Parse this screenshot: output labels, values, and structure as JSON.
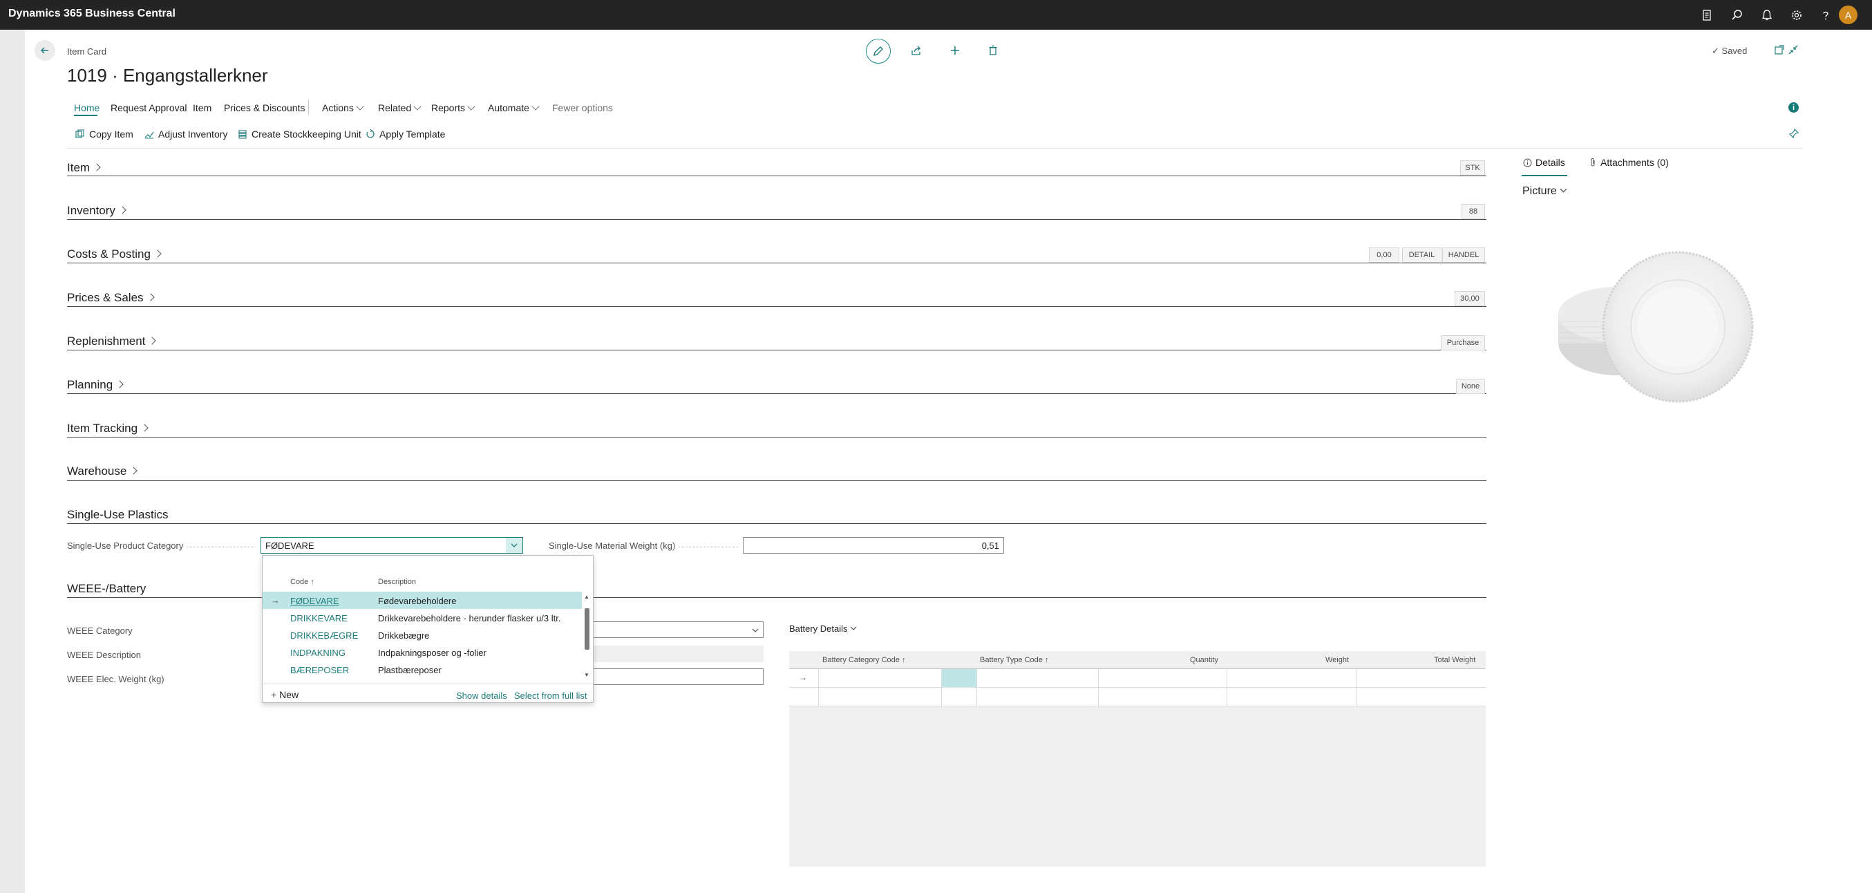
{
  "app": {
    "title": "Dynamics 365 Business Central",
    "avatar_initial": "A"
  },
  "header": {
    "breadcrumb": "Item Card",
    "title": "1019 · Engangstallerkner",
    "saved_label": "Saved"
  },
  "menu": {
    "items": [
      "Home",
      "Request Approval",
      "Item",
      "Prices & Discounts"
    ],
    "dropdowns": [
      "Actions",
      "Related",
      "Reports",
      "Automate"
    ],
    "fewer": "Fewer options"
  },
  "actions": [
    "Copy Item",
    "Adjust Inventory",
    "Create Stockkeeping Unit",
    "Apply Template"
  ],
  "fasttabs": [
    {
      "title": "Item",
      "badges": [
        "STK"
      ]
    },
    {
      "title": "Inventory",
      "badges": [
        "88"
      ]
    },
    {
      "title": "Costs & Posting",
      "badges": [
        "0,00",
        "DETAIL",
        "HANDEL"
      ]
    },
    {
      "title": "Prices & Sales",
      "badges": [
        "30,00"
      ]
    },
    {
      "title": "Replenishment",
      "badges": [
        "Purchase"
      ]
    },
    {
      "title": "Planning",
      "badges": [
        "None"
      ]
    },
    {
      "title": "Item Tracking",
      "badges": []
    },
    {
      "title": "Warehouse",
      "badges": []
    }
  ],
  "single_use": {
    "title": "Single-Use Plastics",
    "category_label": "Single-Use Product Category",
    "category_value": "FØDEVARE",
    "weight_label": "Single-Use Material Weight (kg)",
    "weight_value": "0,51"
  },
  "lookup": {
    "code_header": "Code ↑",
    "desc_header": "Description",
    "rows": [
      {
        "code": "FØDEVARE",
        "desc": "Fødevarebeholdere"
      },
      {
        "code": "DRIKKEVARE",
        "desc": "Drikkevarebeholdere - herunder flasker u/3 ltr."
      },
      {
        "code": "DRIKKEBÆGRE",
        "desc": "Drikkebægre"
      },
      {
        "code": "INDPAKNING",
        "desc": "Indpakningsposer og -folier"
      },
      {
        "code": "BÆREPOSER",
        "desc": "Plastbæreposer"
      }
    ],
    "new_label": "New",
    "show_details": "Show details",
    "select_full": "Select from full list"
  },
  "weee": {
    "title": "WEEE-/Battery",
    "category_label": "WEEE Category",
    "description_label": "WEEE Description",
    "weight_label": "WEEE Elec. Weight (kg)"
  },
  "battery": {
    "title": "Battery Details",
    "columns": [
      "Battery Category Code ↑",
      "Battery Type Code ↑",
      "Quantity",
      "Weight",
      "Total Weight"
    ]
  },
  "right_pane": {
    "tabs": [
      "Details",
      "Attachments (0)"
    ],
    "picture_label": "Picture"
  }
}
